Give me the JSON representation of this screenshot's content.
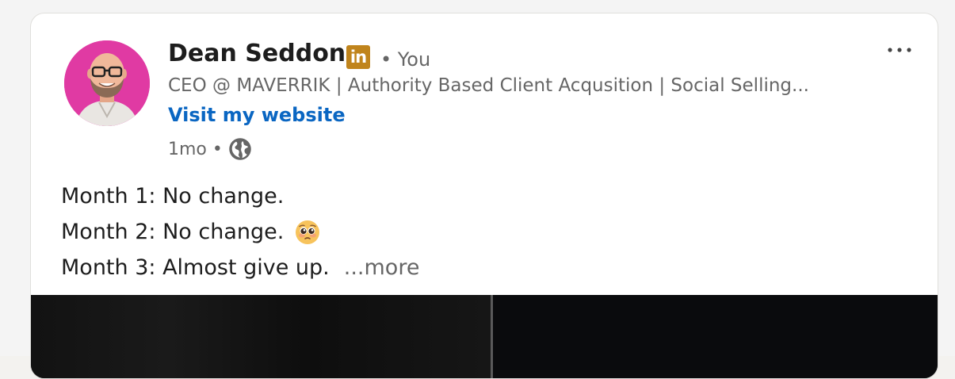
{
  "post": {
    "author": {
      "name": "Dean Seddon",
      "badge_label": "in",
      "degree": "• You",
      "headline": "CEO @ MAVERRIK | Authority Based Client Acqusition | Social Selling...",
      "website_link": "Visit my website",
      "time": "1mo",
      "visibility_icon": "globe-icon",
      "avatar_bg": "#e03aa3"
    },
    "menu_icon": "more-horizontal-icon",
    "body": {
      "lines": [
        "Month 1: No change.",
        "Month 2: No change.",
        "Month 3: Almost give up."
      ],
      "emoji": "pleading-face-emoji",
      "see_more": "...more"
    },
    "media": {
      "type": "video-thumbnail",
      "background": "#0b0c0d"
    }
  },
  "colors": {
    "link": "#0a66c2",
    "secondary_text": "#666666",
    "primary_text": "#1d1d1d",
    "linkedin_premium_badge": "#c0841c"
  }
}
